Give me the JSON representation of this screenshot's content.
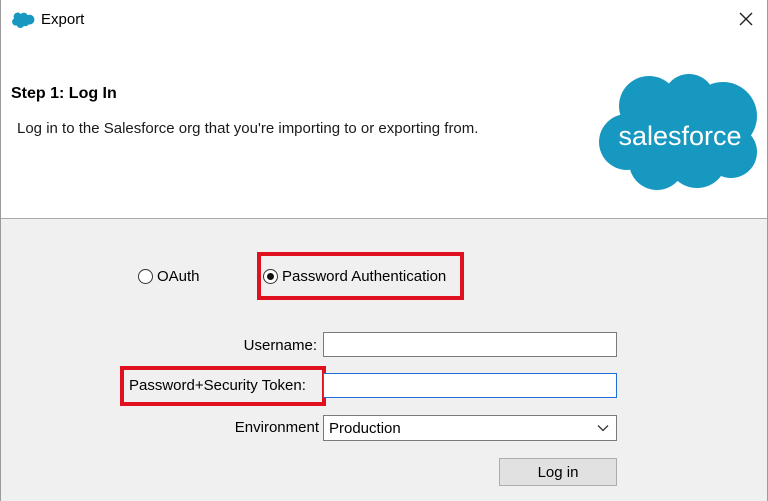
{
  "window": {
    "title": "Export",
    "close_symbol": "✕"
  },
  "header": {
    "step_title": "Step 1: Log In",
    "description": "Log in to the Salesforce org that you're importing to or exporting from.",
    "logo_text": "salesforce",
    "logo_color": "#1798c1"
  },
  "auth": {
    "options": [
      {
        "label": "OAuth",
        "selected": false
      },
      {
        "label": "Password Authentication",
        "selected": true
      }
    ]
  },
  "form": {
    "username_label": "Username:",
    "username_value": "",
    "password_label": "Password+Security Token:",
    "password_value": "",
    "environment_label": "Environment",
    "environment_value": "Production",
    "login_button": "Log in"
  },
  "colors": {
    "highlight": "#e0101e",
    "panel_bg": "#f0f0f0",
    "focus_border": "#1f6fd6"
  }
}
